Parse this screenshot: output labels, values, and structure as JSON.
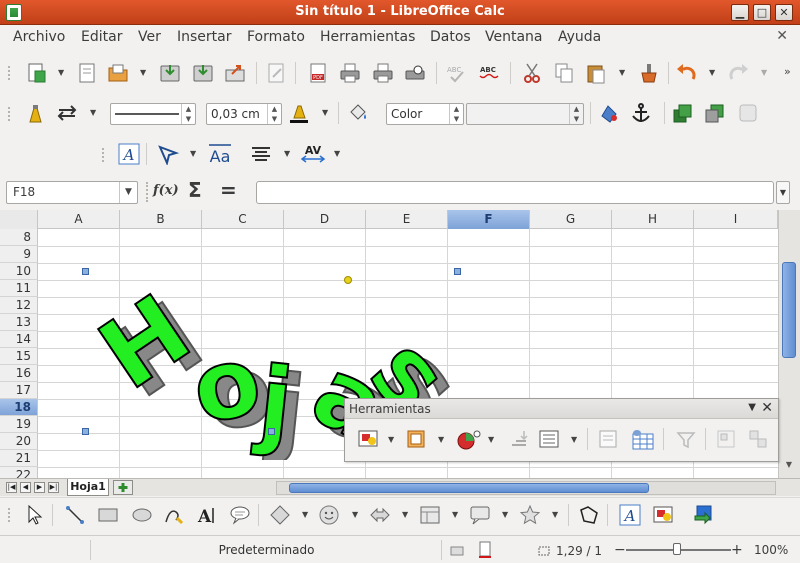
{
  "window": {
    "title": "Sin título 1 - LibreOffice Calc",
    "minimize_glyph": "▁",
    "maximize_glyph": "□",
    "close_glyph": "✕"
  },
  "menu": {
    "items": [
      "Archivo",
      "Editar",
      "Ver",
      "Insertar",
      "Formato",
      "Herramientas",
      "Datos",
      "Ventana",
      "Ayuda"
    ],
    "close_doc_glyph": "✕"
  },
  "format_toolbar": {
    "line_width": "0,03 cm",
    "area_style": "Color",
    "area_fill": ""
  },
  "formula_bar": {
    "cell_reference": "F18",
    "formula_value": "",
    "function_wizard_glyph": "f(x)",
    "sum_glyph": "Σ",
    "equals_glyph": "="
  },
  "grid": {
    "columns": [
      "A",
      "B",
      "C",
      "D",
      "E",
      "F",
      "G",
      "H",
      "I"
    ],
    "selected_column": "F",
    "rows": [
      "8",
      "9",
      "10",
      "11",
      "12",
      "13",
      "14",
      "15",
      "16",
      "17",
      "18",
      "19",
      "20",
      "21",
      "22"
    ],
    "selected_row": "18"
  },
  "fontwork": {
    "text": "Hojas",
    "fill_color": "#22ee22",
    "outline_color": "#000000",
    "shadow_color": "#888888"
  },
  "floating_toolbar": {
    "title": "Herramientas",
    "menu_glyph": "▼",
    "close_glyph": "✕"
  },
  "sheet_tabs": {
    "active": "Hoja1"
  },
  "status": {
    "page_style": "Predeterminado",
    "position": "1,29 / 1",
    "zoom": "100%",
    "zoom_minus": "−",
    "zoom_plus": "+"
  },
  "colors": {
    "titlebar": "#d24d22",
    "selection_header": "#7ea3d8",
    "accent_green": "#22ee22"
  }
}
